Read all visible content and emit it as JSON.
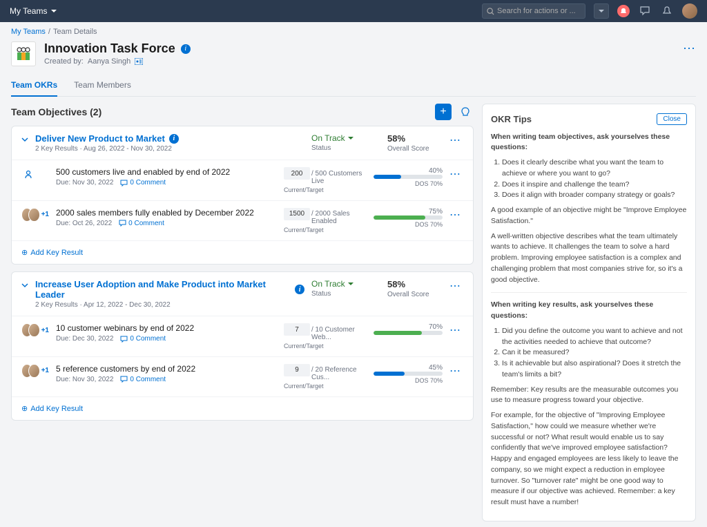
{
  "topbar": {
    "menu": "My Teams",
    "search_placeholder": "Search for actions or ..."
  },
  "breadcrumb": {
    "root": "My Teams",
    "sep": "/",
    "current": "Team Details"
  },
  "header": {
    "title": "Innovation Task Force",
    "created_label": "Created by:",
    "creator": "Aanya Singh"
  },
  "tabs": {
    "okrs": "Team OKRs",
    "members": "Team Members"
  },
  "section": {
    "title": "Team Objectives (2)"
  },
  "objectives": [
    {
      "title": "Deliver New Product to Market",
      "meta": "2 Key Results · Aug 26, 2022 - Nov 30, 2022",
      "status": "On Track",
      "status_label": "Status",
      "score": "58%",
      "score_label": "Overall Score",
      "krs": [
        {
          "title": "500 customers live and enabled by end of 2022",
          "due": "Due: Nov 30, 2022",
          "comments": "0 Comment",
          "current": "200",
          "target": "/ 500 Customers Live",
          "ct_label": "Current/Target",
          "pct": "40%",
          "dos": "DOS 70%",
          "color": "blue",
          "width": "40%",
          "avatar": "single"
        },
        {
          "title": "2000 sales members fully enabled by December 2022",
          "due": "Due: Oct 26, 2022",
          "comments": "0 Comment",
          "current": "1500",
          "target": "/ 2000 Sales Enabled",
          "ct_label": "Current/Target",
          "pct": "75%",
          "dos": "DOS 70%",
          "color": "green",
          "width": "75%",
          "avatar": "multi",
          "plus": "+1"
        }
      ],
      "add": "Add Key Result"
    },
    {
      "title": "Increase User Adoption and Make Product into Market Leader",
      "meta": "2 Key Results · Apr 12, 2022 - Dec 30, 2022",
      "status": "On Track",
      "status_label": "Status",
      "score": "58%",
      "score_label": "Overall Score",
      "krs": [
        {
          "title": "10 customer webinars by end of 2022",
          "due": "Due: Dec 30, 2022",
          "comments": "0 Comment",
          "current": "7",
          "target": "/ 10 Customer Web...",
          "ct_label": "Current/Target",
          "pct": "70%",
          "dos": "",
          "color": "green",
          "width": "70%",
          "avatar": "multi",
          "plus": "+1"
        },
        {
          "title": "5 reference customers by end of 2022",
          "due": "Due: Nov 30, 2022",
          "comments": "0 Comment",
          "current": "9",
          "target": "/ 20 Reference Cus...",
          "ct_label": "Current/Target",
          "pct": "45%",
          "dos": "DOS 70%",
          "color": "blue",
          "width": "45%",
          "avatar": "multi",
          "plus": "+1"
        }
      ],
      "add": "Add Key Result"
    }
  ],
  "tips": {
    "title": "OKR Tips",
    "close": "Close",
    "q1_head": "When writing team objectives, ask yourselves these questions:",
    "q1_1": "Does it clearly describe what you want the team to achieve or where you want to go?",
    "q1_2": "Does it inspire and challenge the team?",
    "q1_3": "Does it align with broader company strategy or goals?",
    "ex1": "A good example of an objective might be \"Improve Employee Satisfaction.\"",
    "p1": "A well-written objective describes what the team ultimately wants to achieve. It challenges the team to solve a hard problem. Improving employee satisfaction is a complex and challenging problem that most companies strive for, so it's a good objective.",
    "q2_head": "When writing key results, ask yourselves these questions:",
    "q2_1": "Did you define the outcome you want to achieve and not the activities needed to achieve that outcome?",
    "q2_2": "Can it be measured?",
    "q2_3": "Is it achievable but also aspirational? Does it stretch the team's limits a bit?",
    "p2": "Remember: Key results are the measurable outcomes you use to measure progress toward your objective.",
    "p3": "For example, for the objective of \"Improving Employee Satisfaction,\" how could we measure whether we're successful or not? What result would enable us to say confidently that we've improved employee satisfaction? Happy and engaged employees are less likely to leave the company, so we might expect a reduction in employee turnover. So \"turnover rate\" might be one good way to measure if our objective was achieved. Remember: a key result must have a number!"
  }
}
